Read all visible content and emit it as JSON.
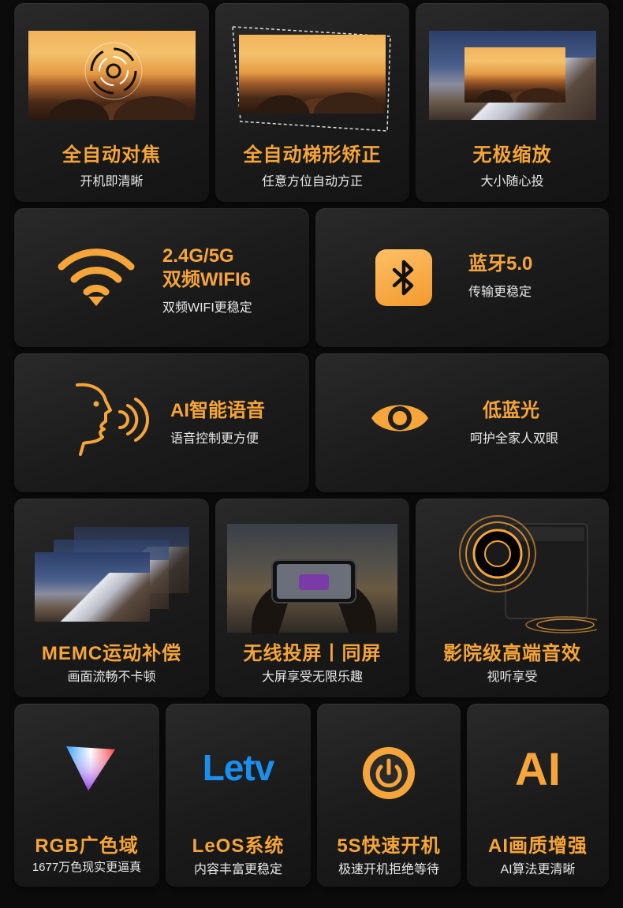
{
  "accent": "#f6a53a",
  "row1": [
    {
      "title": "全自动对焦",
      "sub": "开机即清晰",
      "icon": "focus-target-icon"
    },
    {
      "title": "全自动梯形矫正",
      "sub": "任意方位自动方正",
      "icon": "keystone-frame-icon"
    },
    {
      "title": "无极缩放",
      "sub": "大小随心投",
      "icon": "zoom-frame-icon"
    }
  ],
  "row2": [
    {
      "title1": "2.4G/5G",
      "title2": "双频WIFI6",
      "sub": "双频WIFI更稳定",
      "icon": "wifi-icon"
    },
    {
      "title1": "蓝牙5.0",
      "sub": "传输更稳定",
      "icon": "bluetooth-icon"
    }
  ],
  "row3": [
    {
      "title1": "AI智能语音",
      "sub": "语音控制更方便",
      "icon": "voice-face-icon"
    },
    {
      "title1": "低蓝光",
      "sub": "呵护全家人双眼",
      "icon": "eye-icon"
    }
  ],
  "row4": [
    {
      "title": "MEMC运动补偿",
      "sub": "画面流畅不卡顿",
      "icon": "stacked-frames-icon"
    },
    {
      "title": "无线投屏丨同屏",
      "sub": "大屏享受无限乐趣",
      "icon": "phone-cast-icon"
    },
    {
      "title": "影院级高端音效",
      "sub": "视听享受",
      "icon": "speaker-icon"
    }
  ],
  "row5": [
    {
      "title": "RGB广色域",
      "sub": "1677万色现实更逼真",
      "icon": "color-gamut-icon"
    },
    {
      "title": "LeOS系统",
      "sub": "内容丰富更稳定",
      "icon": "letv-logo-icon",
      "logo": "Letv"
    },
    {
      "title": "5S快速开机",
      "sub": "极速开机拒绝等待",
      "icon": "power-icon"
    },
    {
      "title": "AI画质增强",
      "sub": "AI算法更清晰",
      "icon": "ai-icon",
      "logo": "AI"
    }
  ]
}
